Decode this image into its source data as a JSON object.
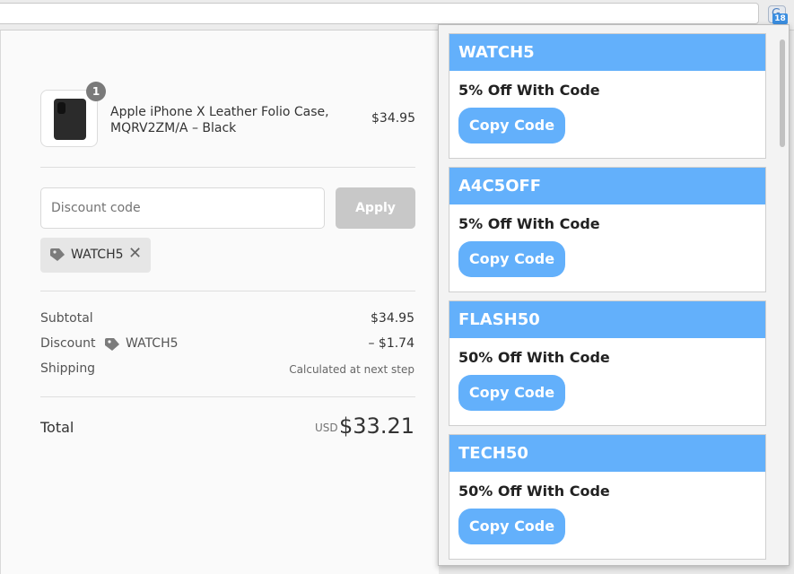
{
  "browser": {
    "extension_badge": "18",
    "extension_icon": "coupon-extension-icon"
  },
  "order": {
    "product": {
      "quantity": "1",
      "name": "Apple iPhone X Leather Folio Case, MQRV2ZM/A – Black",
      "price": "$34.95"
    },
    "discount": {
      "placeholder": "Discount code",
      "apply_label": "Apply",
      "applied_code": "WATCH5",
      "remove_symbol": "✕"
    },
    "summary": {
      "subtotal_label": "Subtotal",
      "subtotal_value": "$34.95",
      "discount_label": "Discount",
      "discount_code": "WATCH5",
      "discount_value": "– $1.74",
      "shipping_label": "Shipping",
      "shipping_value": "Calculated at next step"
    },
    "total": {
      "label": "Total",
      "currency": "USD",
      "amount": "$33.21"
    }
  },
  "coupons": {
    "copy_label": "Copy Code",
    "items": [
      {
        "code": "WATCH5",
        "description": "5% Off With Code"
      },
      {
        "code": "A4C5OFF",
        "description": "5% Off With Code"
      },
      {
        "code": "FLASH50",
        "description": "50% Off With Code"
      },
      {
        "code": "TECH50",
        "description": "50% Off With Code"
      }
    ]
  },
  "colors": {
    "accent": "#63b0fb",
    "apply_disabled": "#c8c8c8",
    "chip_bg": "#e6e6e6"
  }
}
